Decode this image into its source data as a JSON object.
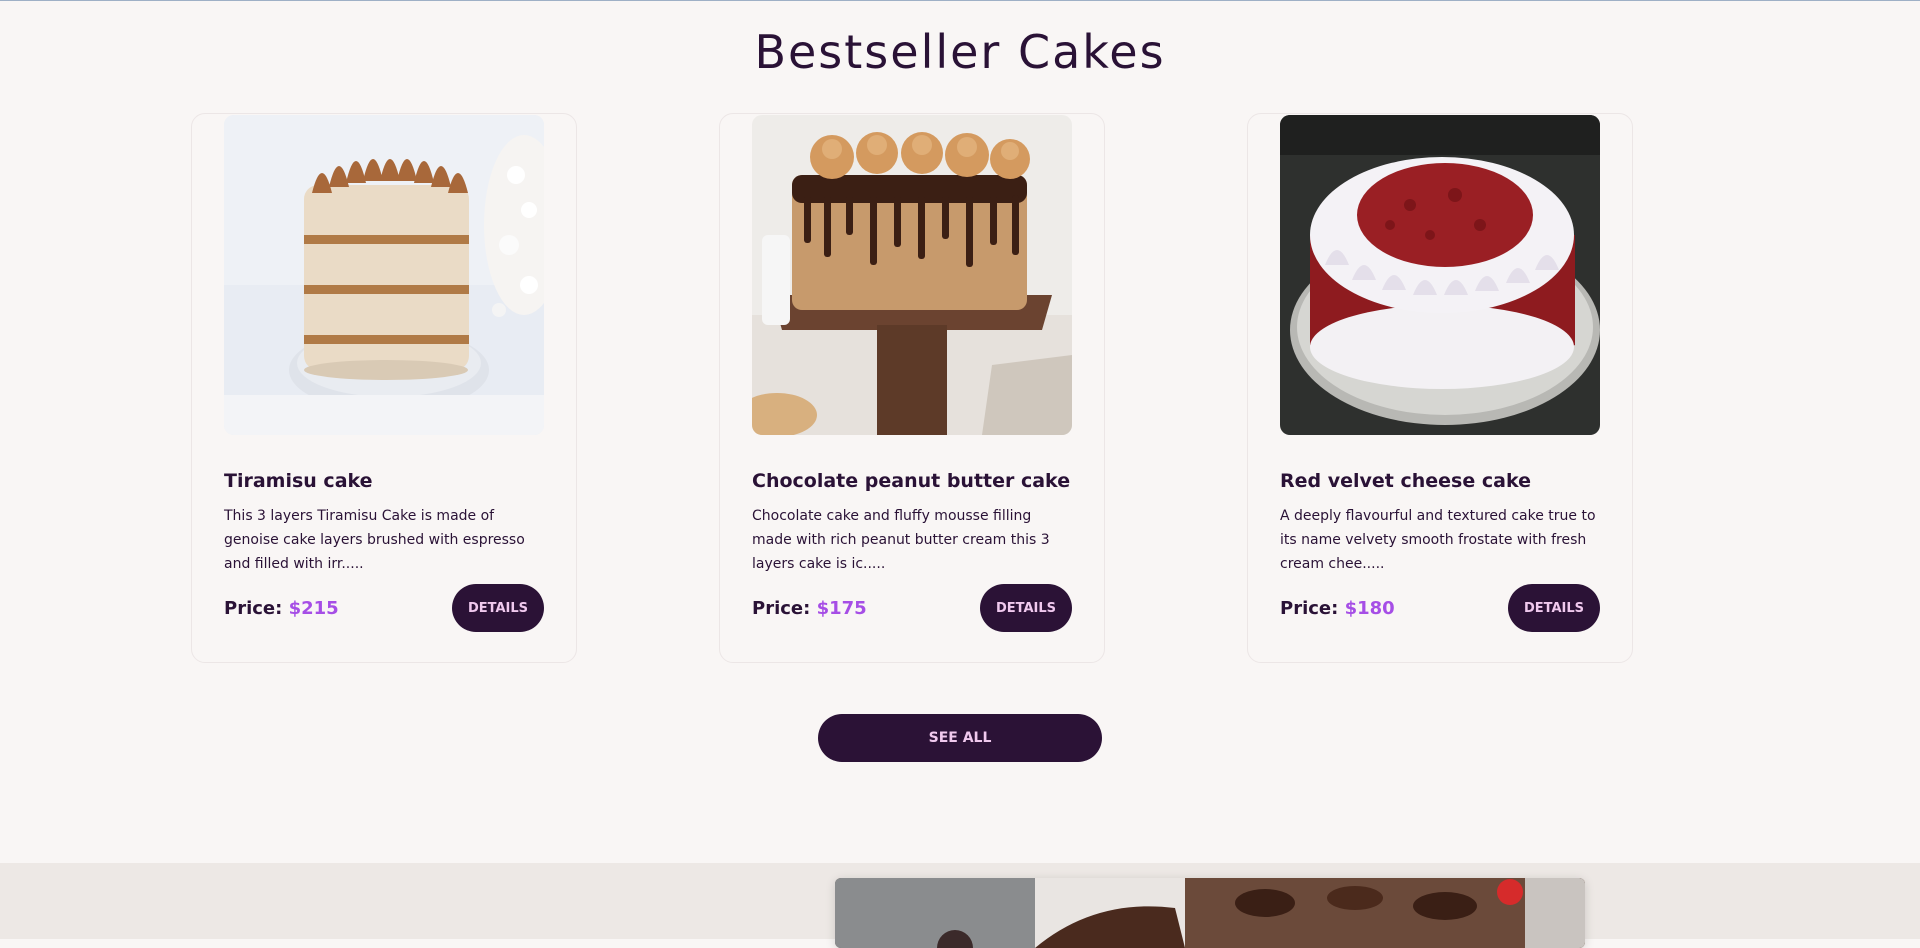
{
  "section": {
    "title": "Bestseller Cakes"
  },
  "cards": [
    {
      "name": "Tiramisu cake",
      "description": "This 3 layers Tiramisu Cake is made of genoise cake layers brushed with espresso and filled with irr.....",
      "price_label": "Price:",
      "price": "$215",
      "details_label": "DETAILS"
    },
    {
      "name": "Chocolate peanut butter cake",
      "description": "Chocolate cake and fluffy mousse filling made with rich peanut butter cream this 3 layers cake is ic.....",
      "price_label": "Price:",
      "price": "$175",
      "details_label": "DETAILS"
    },
    {
      "name": "Red velvet cheese cake",
      "description": "A deeply flavourful and textured cake true to its name velvety smooth frostate with fresh cream chee.....",
      "price_label": "Price:",
      "price": "$180",
      "details_label": "DETAILS"
    }
  ],
  "see_all_label": "SEE ALL",
  "colors": {
    "background": "#f9f6f5",
    "dark_purple": "#2b1236",
    "button_text": "#f0c9ee",
    "price_accent": "#a64ee6",
    "next_section_bg": "#ede8e5"
  }
}
